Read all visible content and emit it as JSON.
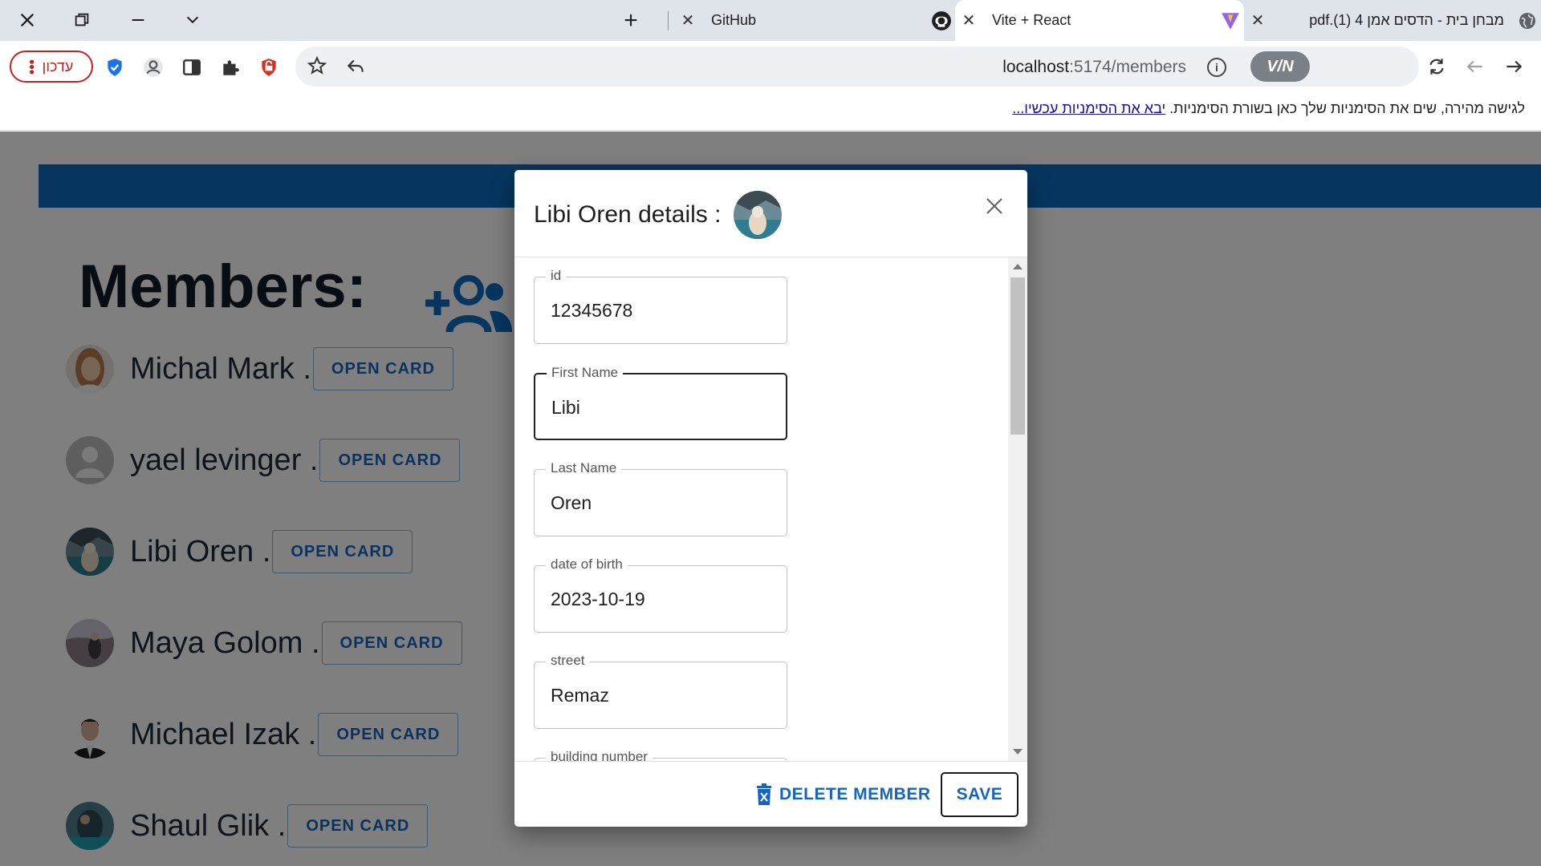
{
  "browser": {
    "tabs": [
      {
        "title": "GitHub"
      },
      {
        "title": "Vite + React"
      },
      {
        "title": "pdf.(1) 4 מבחן בית - הדסים אמן"
      }
    ],
    "update_button": "עדכון",
    "url_host": "localhost",
    "url_path": ":5174/members",
    "vpn_label": "V/N",
    "bookmark_hint": "לגישה מהירה, שים את הסימניות שלך כאן בשורת הסימניות.",
    "bookmark_link": "יבא את הסימניות עכשיו..."
  },
  "page": {
    "title": "Members:",
    "open_card_label": "OPEN CARD",
    "members": [
      {
        "name": "Michal Mark .",
        "avatar_color": "#c9a07f"
      },
      {
        "name": "yael levinger .",
        "avatar_color": "#bdbdbd"
      },
      {
        "name": "Libi Oren .",
        "avatar_color": "#3c6a78"
      },
      {
        "name": "Maya Golom .",
        "avatar_color": "#8d8c9a"
      },
      {
        "name": "Michael Izak .",
        "avatar_color": "#2e2e2e"
      },
      {
        "name": "Shaul Glik .",
        "avatar_color": "#2f6f82"
      }
    ]
  },
  "dialog": {
    "title": "Libi Oren details :",
    "fields": [
      {
        "label": "id",
        "value": "12345678"
      },
      {
        "label": "First Name",
        "value": "Libi"
      },
      {
        "label": "Last Name",
        "value": "Oren"
      },
      {
        "label": "date of birth",
        "value": "2023-10-19"
      },
      {
        "label": "street",
        "value": "Remaz"
      },
      {
        "label": "building number",
        "value": ""
      }
    ],
    "delete_label": "DELETE MEMBER",
    "save_label": "SAVE"
  },
  "colors": {
    "accent": "#1565c0",
    "header_blue": "#0d6cc0",
    "update_red": "#c5221f"
  }
}
